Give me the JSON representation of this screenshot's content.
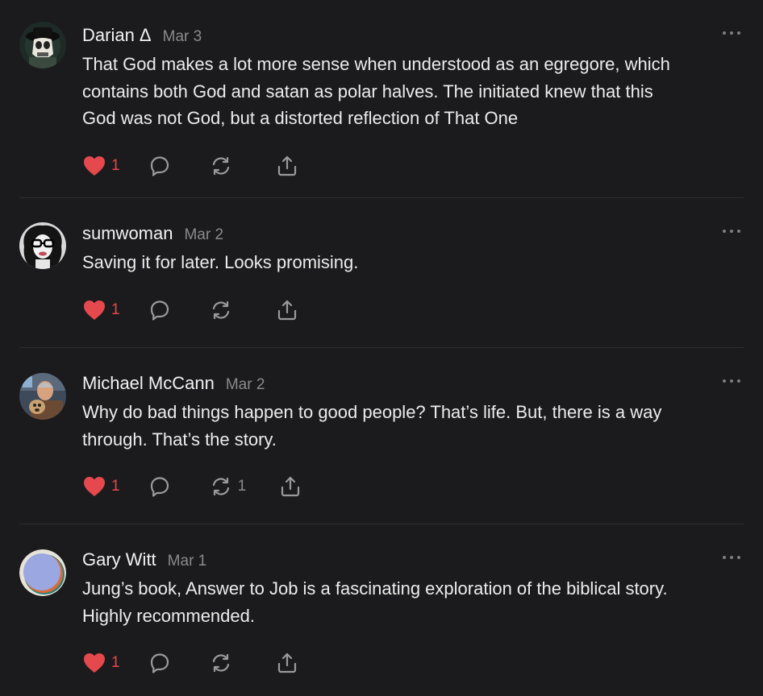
{
  "comments": [
    {
      "author": "Darian Δ",
      "date": "Mar 3",
      "lines": [
        "That God makes a lot more sense when understood as an egregore, which",
        "contains both God and satan as polar halves. The initiated knew that this",
        "God was not God, but a distorted reflection of That One"
      ],
      "likes": "1",
      "restacks": ""
    },
    {
      "author": "sumwoman",
      "date": "Mar 2",
      "lines": [
        "Saving it for later. Looks promising."
      ],
      "likes": "1",
      "restacks": ""
    },
    {
      "author": "Michael McCann",
      "date": "Mar 2",
      "lines": [
        "Why do bad things happen to good people? That’s life. But, there is a way",
        "through. That’s the story."
      ],
      "likes": "1",
      "restacks": "1"
    },
    {
      "author": "Gary Witt",
      "date": "Mar 1",
      "lines": [
        "Jung’s book, Answer to Job is a fascinating exploration of the biblical story.",
        "Highly recommended."
      ],
      "likes": "1",
      "restacks": ""
    }
  ],
  "colors": {
    "background": "#1b1b1d",
    "like_active": "#e5484d",
    "muted": "#8a8a8e",
    "icon": "#9a9a9e"
  },
  "icons": {
    "like": "heart-icon",
    "reply": "speech-bubble-icon",
    "restack": "restack-arrows-icon",
    "share": "share-upload-icon",
    "more": "more-dots-icon"
  }
}
